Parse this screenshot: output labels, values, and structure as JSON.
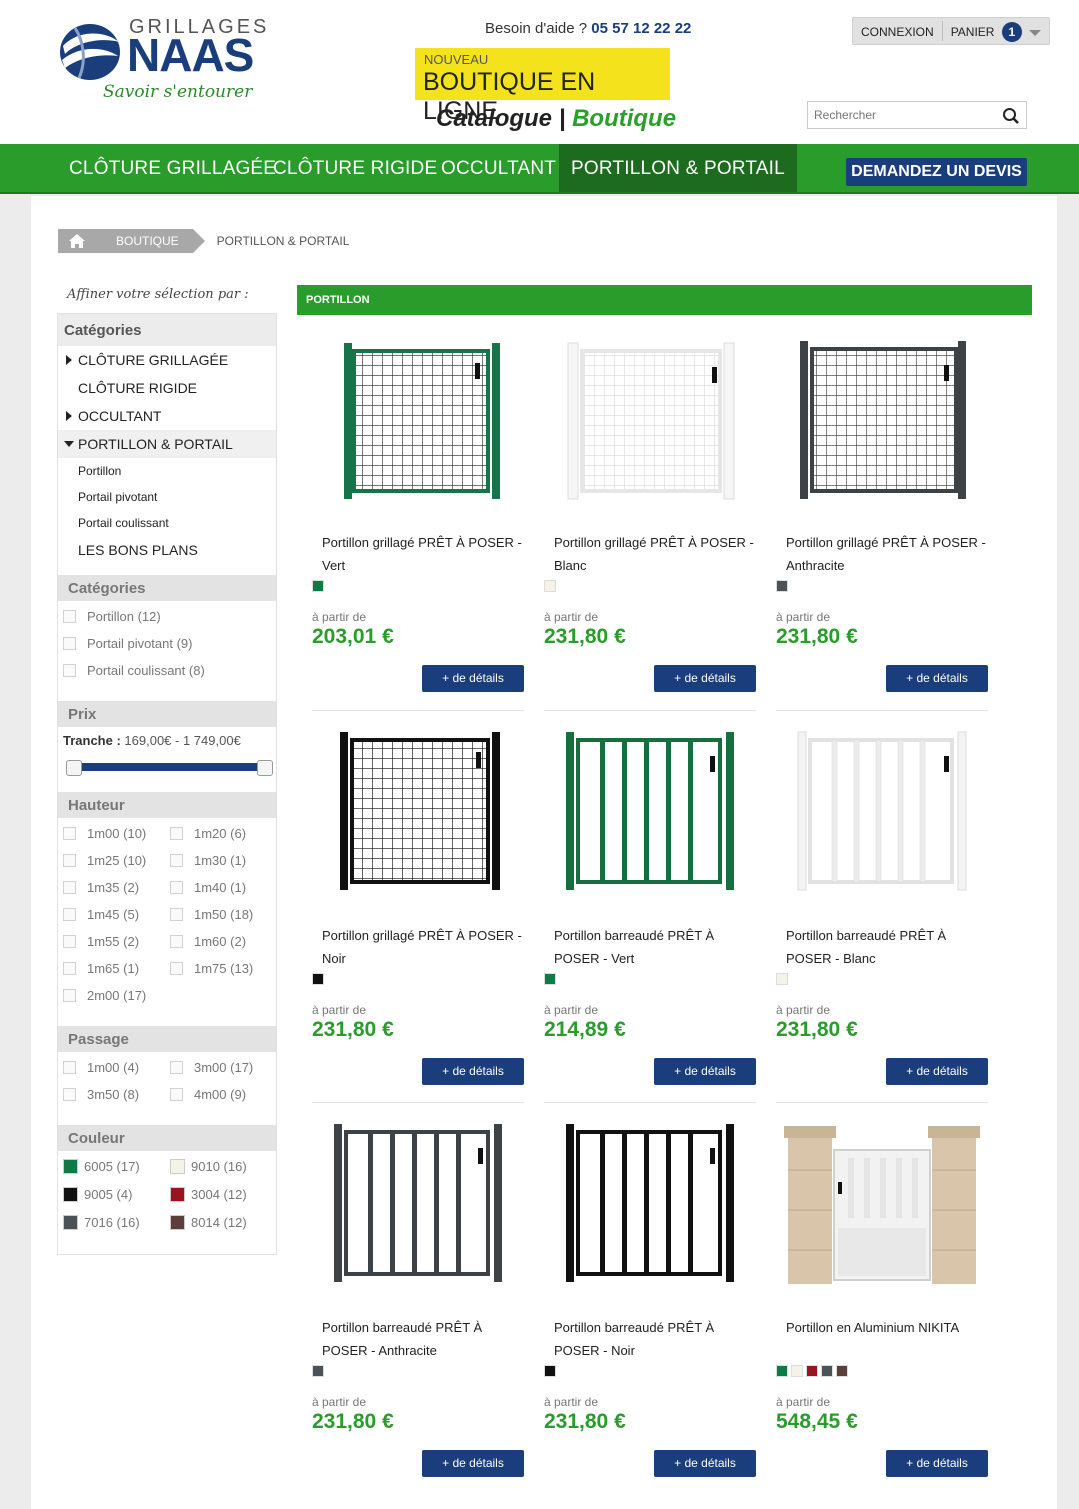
{
  "header": {
    "logo": {
      "brand_top": "GRILLAGES",
      "brand_main": "NAAS",
      "tagline": "Savoir s'entourer"
    },
    "help_label": "Besoin d'aide ?",
    "help_phone": "05 57 12 22 22",
    "promo": {
      "new_label": "NOUVEAU",
      "shop_label": "BOUTIQUE EN LIGNE"
    },
    "catalog_label": "Catalogue",
    "catalog_sep": "|",
    "boutique_label": "Boutique",
    "login_label": "CONNEXION",
    "cart_label": "PANIER",
    "cart_count": "1",
    "search_placeholder": "Rechercher"
  },
  "nav": {
    "items": [
      {
        "label": "CLÔTURE GRILLAGÉE"
      },
      {
        "label": "CLÔTURE RIGIDE"
      },
      {
        "label": "OCCULTANT"
      },
      {
        "label": "PORTILLON & PORTAIL"
      }
    ],
    "quote_label": "DEMANDEZ UN DEVIS"
  },
  "breadcrumb": {
    "shop": "BOUTIQUE",
    "current": "PORTILLON & PORTAIL"
  },
  "sidebar": {
    "refine_label": "Affiner votre sélection par :",
    "categories_title": "Catégories",
    "categories": [
      {
        "label": "CLÔTURE GRILLAGÉE"
      },
      {
        "label": "CLÔTURE RIGIDE"
      },
      {
        "label": "OCCULTANT"
      },
      {
        "label": "PORTILLON & PORTAIL"
      }
    ],
    "sub_items": [
      {
        "label": "Portillon"
      },
      {
        "label": "Portail pivotant"
      },
      {
        "label": "Portail coulissant"
      }
    ],
    "bons_plans": "LES BONS PLANS",
    "filter_categories_title": "Catégories",
    "filter_categories": [
      {
        "label": "Portillon (12)"
      },
      {
        "label": "Portail pivotant (9)"
      },
      {
        "label": "Portail coulissant (8)"
      }
    ],
    "price_title": "Prix",
    "price_label": "Tranche :",
    "price_range": "169,00€ - 1 749,00€",
    "height_title": "Hauteur",
    "heights": [
      {
        "label": "1m00 (10)"
      },
      {
        "label": "1m20 (6)"
      },
      {
        "label": "1m25 (10)"
      },
      {
        "label": "1m30 (1)"
      },
      {
        "label": "1m35 (2)"
      },
      {
        "label": "1m40 (1)"
      },
      {
        "label": "1m45 (5)"
      },
      {
        "label": "1m50 (18)"
      },
      {
        "label": "1m55 (2)"
      },
      {
        "label": "1m60 (2)"
      },
      {
        "label": "1m65 (1)"
      },
      {
        "label": "1m75 (13)"
      },
      {
        "label": "2m00 (17)"
      }
    ],
    "passage_title": "Passage",
    "passages": [
      {
        "label": "1m00 (4)"
      },
      {
        "label": "3m00 (17)"
      },
      {
        "label": "3m50 (8)"
      },
      {
        "label": "4m00 (9)"
      }
    ],
    "color_title": "Couleur",
    "colors": [
      {
        "label": "6005 (17)",
        "hex": "#0f7a45"
      },
      {
        "label": "9010 (16)",
        "hex": "#f5f3e6"
      },
      {
        "label": "9005 (4)",
        "hex": "#111111"
      },
      {
        "label": "3004 (12)",
        "hex": "#9a1420"
      },
      {
        "label": "7016 (16)",
        "hex": "#4b5258"
      },
      {
        "label": "8014 (12)",
        "hex": "#5c3e3a"
      }
    ]
  },
  "section_title": "PORTILLON",
  "products": [
    {
      "name": "Portillon grillagé PRÊT À POSER - Vert",
      "from": "à partir de",
      "price": "203,01 €",
      "details": "+ de détails"
    },
    {
      "name": "Portillon grillagé PRÊT À POSER - Blanc",
      "from": "à partir de",
      "price": "231,80 €",
      "details": "+ de détails"
    },
    {
      "name": "Portillon grillagé PRÊT À POSER - Anthracite",
      "from": "à partir de",
      "price": "231,80 €",
      "details": "+ de détails"
    },
    {
      "name": "Portillon grillagé PRÊT À POSER - Noir",
      "from": "à partir de",
      "price": "231,80 €",
      "details": "+ de détails"
    },
    {
      "name": "Portillon barreaudé PRÊT À POSER - Vert",
      "from": "à partir de",
      "price": "214,89 €",
      "details": "+ de détails"
    },
    {
      "name": "Portillon barreaudé PRÊT À POSER - Blanc",
      "from": "à partir de",
      "price": "231,80 €",
      "details": "+ de détails"
    },
    {
      "name": "Portillon barreaudé PRÊT À POSER - Anthracite",
      "from": "à partir de",
      "price": "231,80 €",
      "details": "+ de détails"
    },
    {
      "name": "Portillon barreaudé PRÊT À POSER - Noir",
      "from": "à partir de",
      "price": "231,80 €",
      "details": "+ de détails"
    },
    {
      "name": "Portillon en Aluminium NIKITA",
      "from": "à partir de",
      "price": "548,45 €",
      "details": "+ de détails"
    }
  ],
  "colors": {
    "brand_green": "#2a9c2c",
    "brand_blue": "#1a3d7c",
    "promo_yellow": "#f4e31c"
  }
}
